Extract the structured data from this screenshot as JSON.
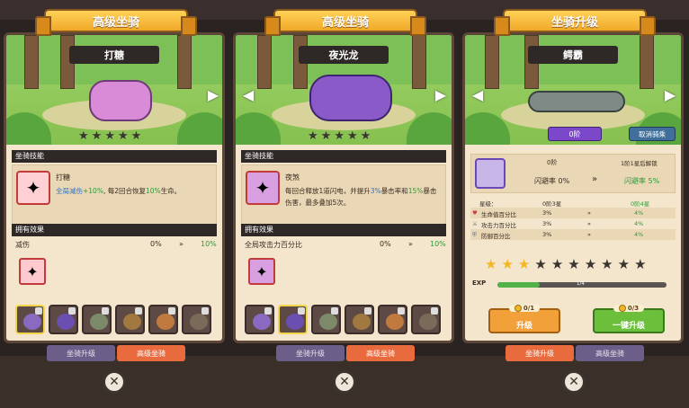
{
  "panels": [
    {
      "banner": "高级坐骑",
      "mount_name": "打糖",
      "stars_total": 5,
      "stars_filled": 0,
      "skill_section": "坐骑技能",
      "skill_name": "打糖",
      "skill_desc_parts": [
        "全局减伤",
        "+10%",
        ", 每2回合恢复",
        "10%",
        "生命。"
      ],
      "effects_section": "拥有效果",
      "effect_label": "减伤",
      "effect_from": "0%",
      "effect_to": "10%",
      "tabs": [
        "坐骑升级",
        "高级坐骑"
      ],
      "active_tab": 1
    },
    {
      "banner": "高级坐骑",
      "mount_name": "夜光龙",
      "stars_total": 5,
      "stars_filled": 0,
      "skill_section": "坐骑技能",
      "skill_name": "夜煞",
      "skill_desc_parts": [
        "每回合释放1道闪电，并提升",
        "3%",
        "暴击率和",
        "15%",
        "暴击伤害，最多叠加5次。"
      ],
      "effects_section": "拥有效果",
      "effect_label": "全局攻击力百分比",
      "effect_from": "0%",
      "effect_to": "10%",
      "tabs": [
        "坐骑升级",
        "高级坐骑"
      ],
      "active_tab": 1
    },
    {
      "banner": "坐骑升级",
      "mount_name": "鳄霸",
      "stage_badge": "0阶",
      "unequip_label": "取消骑乘",
      "stage_header_current": "0阶",
      "stage_header_next": "1阶1星后解锁",
      "dodge_current": "闪避率 0%",
      "dodge_next": "闪避率 5%",
      "star_row": {
        "label": "星级：",
        "current": "0阶3星",
        "next": "0阶4星"
      },
      "stats": [
        {
          "label": "生命值百分比",
          "current": "3%",
          "next": "4%"
        },
        {
          "label": "攻击力百分比",
          "current": "3%",
          "next": "4%"
        },
        {
          "label": "防御百分比",
          "current": "3%",
          "next": "4%"
        }
      ],
      "stars_total": 10,
      "stars_filled": 3,
      "exp_label": "EXP",
      "exp_text": "1/4",
      "exp_fraction": 0.25,
      "upgrade_cost": "0/1",
      "upgrade_label": "升级",
      "oneclick_cost": "0/3",
      "oneclick_label": "一键升级",
      "tabs": [
        "坐骑升级",
        "高级坐骑"
      ],
      "active_tab": 0
    }
  ],
  "arrow_symbol": "»",
  "colors": {
    "accent_orange": "#e96a3c",
    "tab_purple": "#6b5e88",
    "green_button": "#6cbf3a",
    "orange_button": "#f2a03a"
  }
}
